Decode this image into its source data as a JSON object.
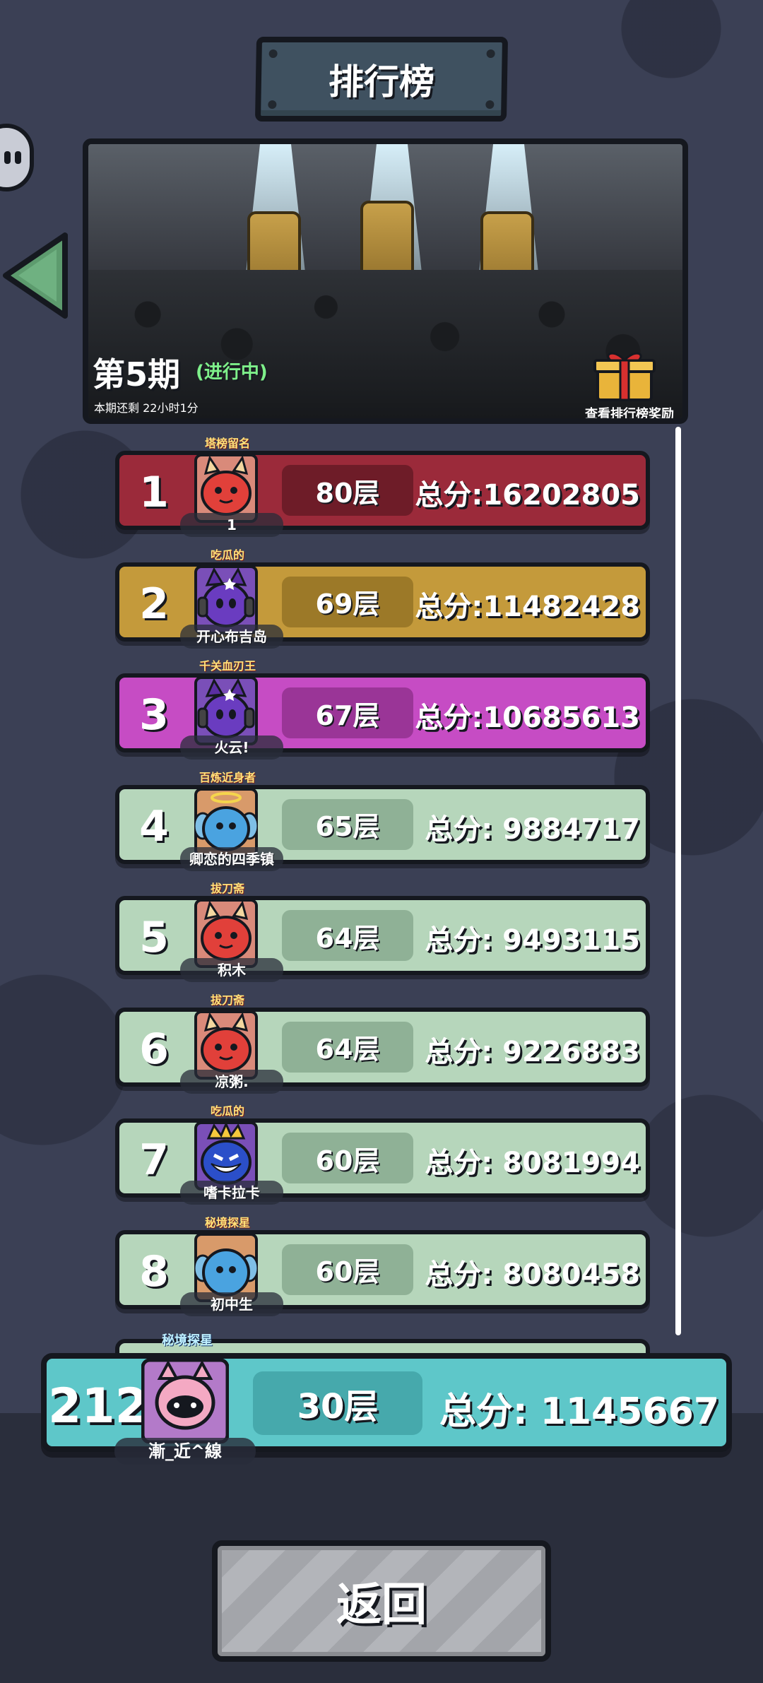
{
  "header": {
    "title": "排行榜"
  },
  "banner": {
    "season": "第5期",
    "status": "(进行中)",
    "countdown": "本期还剩 22小时1分",
    "reward_link": "查看排行榜奖励"
  },
  "rows": [
    {
      "rank": "1",
      "floor": "80层",
      "score": "总分:16202805",
      "name": "1",
      "title": "塔榜留名",
      "theme": "red",
      "avatar": "red-horned-slime-icon"
    },
    {
      "rank": "2",
      "floor": "69层",
      "score": "总分:11482428",
      "name": "开心布吉岛",
      "title": "吃瓜的",
      "theme": "gold",
      "avatar": "purple-headphone-slime-icon"
    },
    {
      "rank": "3",
      "floor": "67层",
      "score": "总分:10685613",
      "name": "火云!",
      "title": "千关血刃王",
      "theme": "purple",
      "avatar": "purple-headphone-slime-icon"
    },
    {
      "rank": "4",
      "floor": "65层",
      "score": "总分: 9884717",
      "name": "卿恋的四季镇",
      "title": "百炼近身者",
      "theme": "green",
      "avatar": "blue-angel-slime-icon"
    },
    {
      "rank": "5",
      "floor": "64层",
      "score": "总分: 9493115",
      "name": "积木",
      "title": "拔刀斋",
      "theme": "green",
      "avatar": "red-horned-slime-icon"
    },
    {
      "rank": "6",
      "floor": "64层",
      "score": "总分: 9226883",
      "name": "凉粥.",
      "title": "拔刀斋",
      "theme": "green",
      "avatar": "red-horned-slime-icon"
    },
    {
      "rank": "7",
      "floor": "60层",
      "score": "总分: 8081994",
      "name": "嗜卡拉卡",
      "title": "吃瓜的",
      "theme": "green",
      "avatar": "blue-crown-slime-icon"
    },
    {
      "rank": "8",
      "floor": "60层",
      "score": "总分: 8080458",
      "name": "初中生",
      "title": "秘境探星",
      "theme": "green",
      "avatar": "blue-winged-slime-icon"
    }
  ],
  "self": {
    "rank": "212",
    "floor": "30层",
    "score": "总分: 1145667",
    "name": "漸_近^線",
    "title": "秘境探星",
    "avatar": "pink-cat-slime-icon"
  },
  "footer": {
    "return_label": "返回"
  },
  "colors": {
    "background": "#3b4055",
    "row_red": "#9b2a3a",
    "row_gold": "#c49a3b",
    "row_purple": "#c64cc4",
    "row_green": "#b6d6bb",
    "self_row": "#5ec7c9",
    "status_green": "#7ef08a"
  }
}
